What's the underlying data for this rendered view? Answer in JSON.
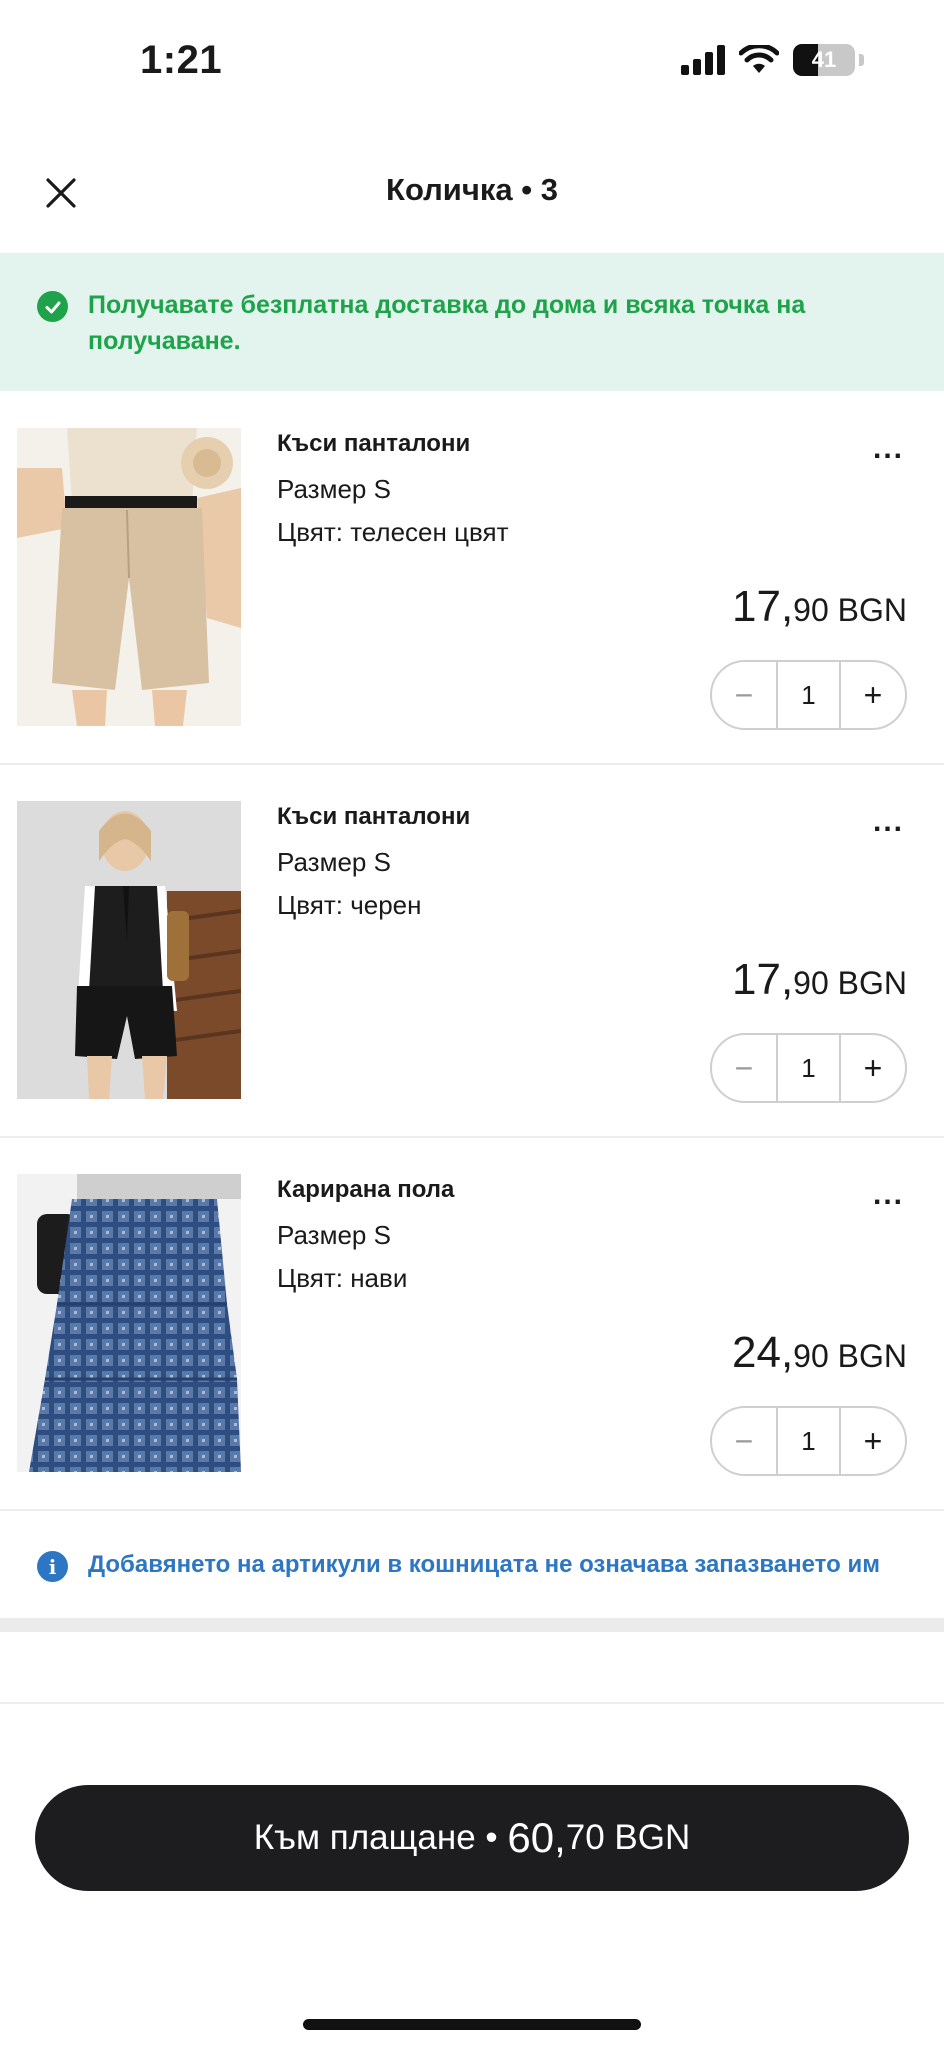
{
  "status_bar": {
    "time": "1:21",
    "battery_level": "41",
    "battery_percent": 41
  },
  "header": {
    "title": "Количка • 3",
    "close_icon": "close-icon"
  },
  "banner": {
    "text": "Получавате безплатна доставка до дома и всяка точка на получаване.",
    "icon": "check-circle-icon",
    "color": "#1fa34a"
  },
  "items": [
    {
      "name": "Къси панталони",
      "size": "Размер S",
      "color_label": "Цвят: телесен цвят",
      "price_main": "17,",
      "price_rest": "90 BGN",
      "quantity": "1",
      "minus": "−",
      "plus": "+",
      "more": "..."
    },
    {
      "name": "Къси панталони",
      "size": "Размер S",
      "color_label": "Цвят: черен",
      "price_main": "17,",
      "price_rest": "90 BGN",
      "quantity": "1",
      "minus": "−",
      "plus": "+",
      "more": "..."
    },
    {
      "name": "Карирана пола",
      "size": "Размер S",
      "color_label": "Цвят: нави",
      "price_main": "24,",
      "price_rest": "90 BGN",
      "quantity": "1",
      "minus": "−",
      "plus": "+",
      "more": "..."
    }
  ],
  "info": {
    "icon_glyph": "i",
    "text": "Добавянето на артикули в кошницата не означава запазването им",
    "color": "#2d76c3"
  },
  "checkout": {
    "label": "Към плащане • ",
    "total_main": "60,",
    "total_rest": "70 BGN"
  }
}
